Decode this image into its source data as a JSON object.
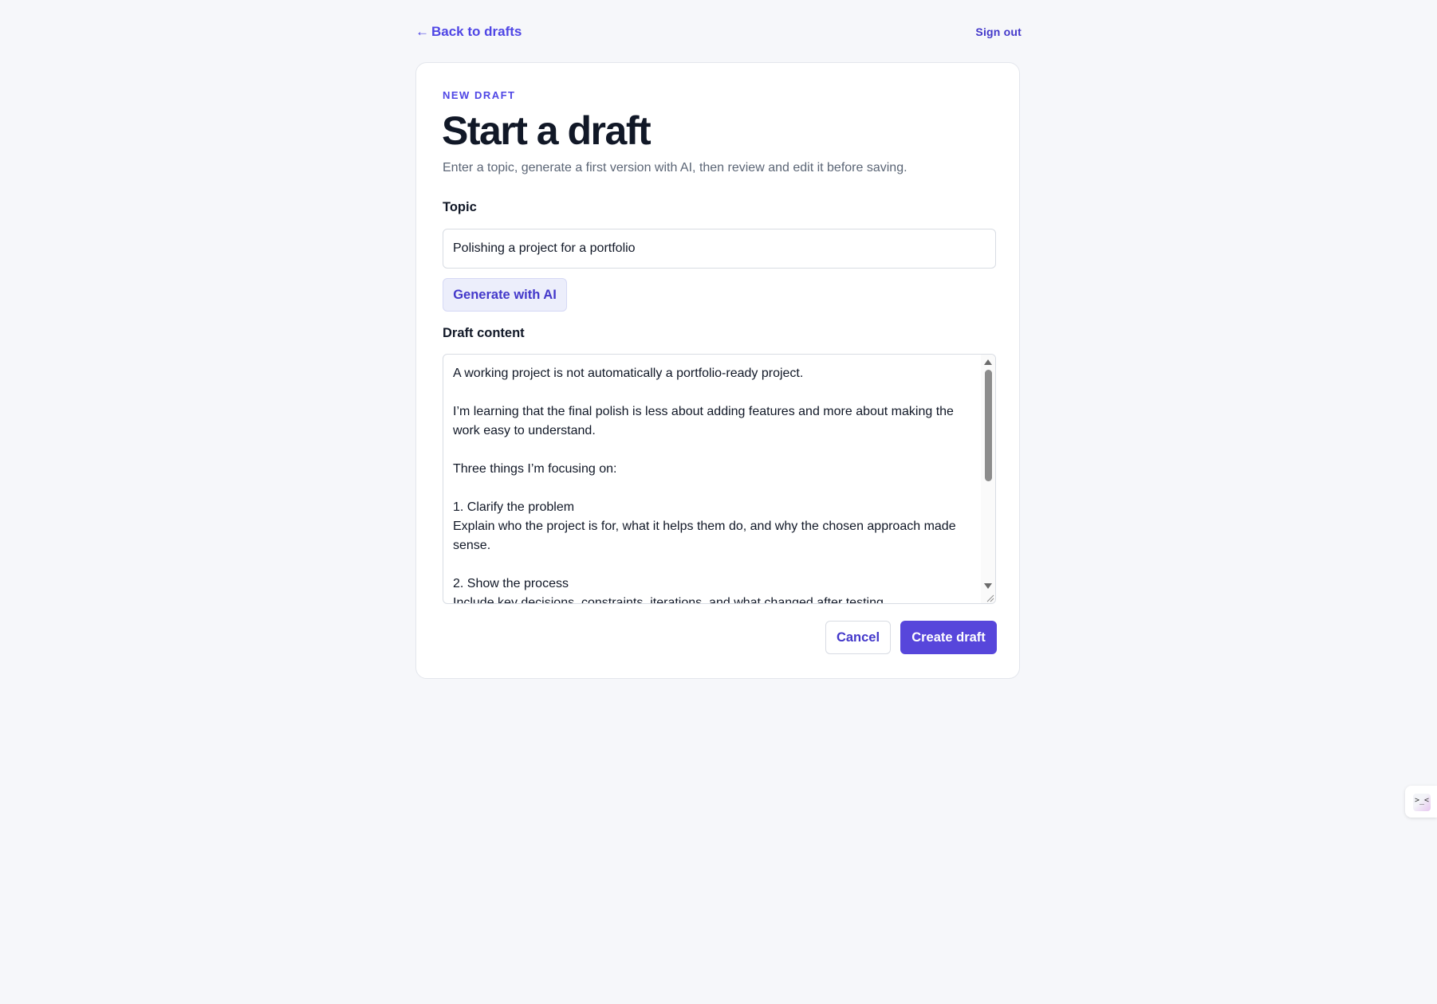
{
  "nav": {
    "back_arrow": "←",
    "back_label": "Back to drafts",
    "sign_out": "Sign out"
  },
  "form": {
    "eyebrow": "NEW DRAFT",
    "title": "Start a draft",
    "subtitle": "Enter a topic, generate a first version with AI, then review and edit it before saving.",
    "topic_label": "Topic",
    "topic_value": "Polishing a project for a portfolio",
    "generate_label": "Generate with AI",
    "content_label": "Draft content",
    "content_value": "A working project is not automatically a portfolio-ready project.\n\nI’m learning that the final polish is less about adding features and more about making the work easy to understand.\n\nThree things I’m focusing on:\n\n1. Clarify the problem\nExplain who the project is for, what it helps them do, and why the chosen approach made sense.\n\n2. Show the process\nInclude key decisions, constraints, iterations, and what changed after testing.",
    "cancel_label": "Cancel",
    "create_label": "Create draft"
  },
  "widget": {
    "icon_glyph": ">_<"
  },
  "colors": {
    "accent": "#4f46e5",
    "primary_button": "#5746db",
    "background": "#f6f7fa"
  }
}
